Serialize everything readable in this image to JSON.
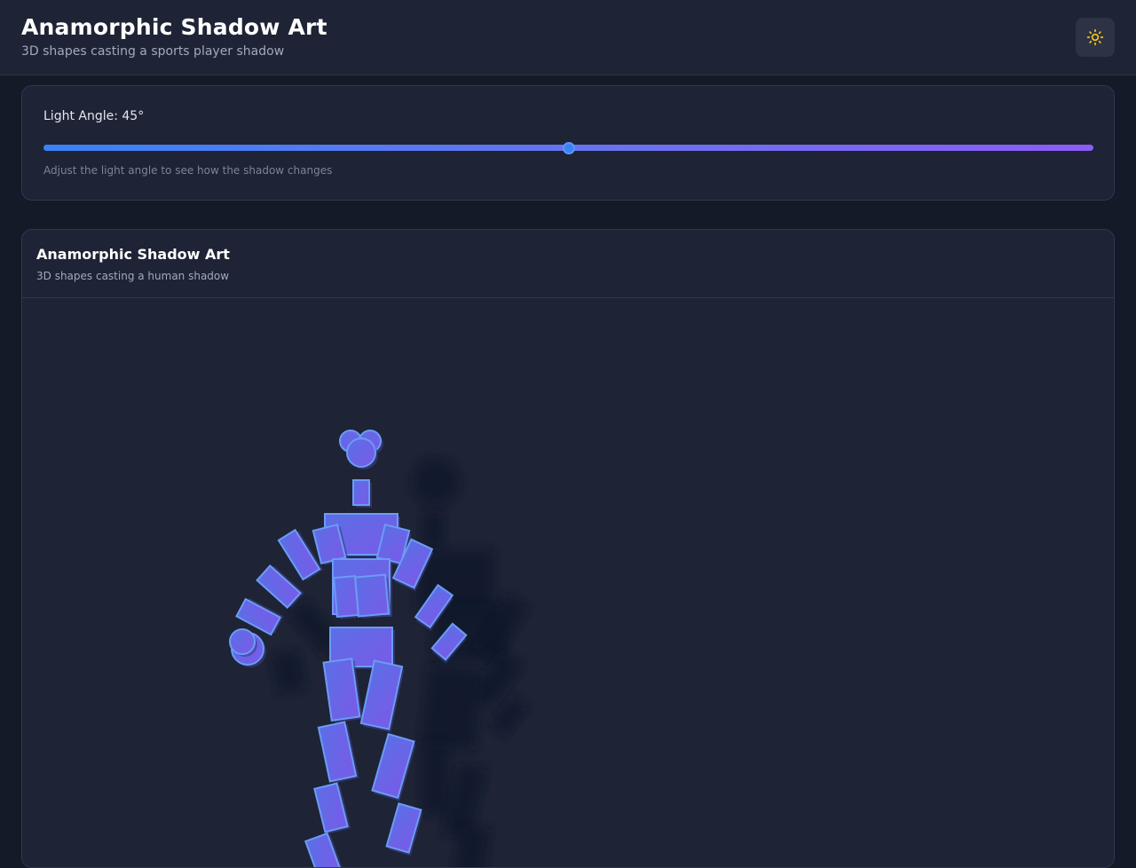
{
  "header": {
    "title": "Anamorphic Shadow Art",
    "subtitle": "3D shapes casting a sports player shadow",
    "theme_toggle_icon": "sun-icon"
  },
  "controls": {
    "slider_label": "Light Angle: 45°",
    "light_angle_degrees": 45,
    "slider_min": 0,
    "slider_max": 90,
    "hint": "Adjust the light angle to see how the shadow changes"
  },
  "art": {
    "title": "Anamorphic Shadow Art",
    "subtitle": "3D shapes casting a human shadow"
  },
  "colors": {
    "accent_blue": "#3b82f6",
    "accent_purple": "#8b5cf6",
    "shape_fill_start": "#5a6fe6",
    "shape_fill_end": "#7a5ae8",
    "shape_stroke": "#6b9cf5",
    "shadow_color": "#10142a",
    "sun_icon": "#f5c518"
  }
}
